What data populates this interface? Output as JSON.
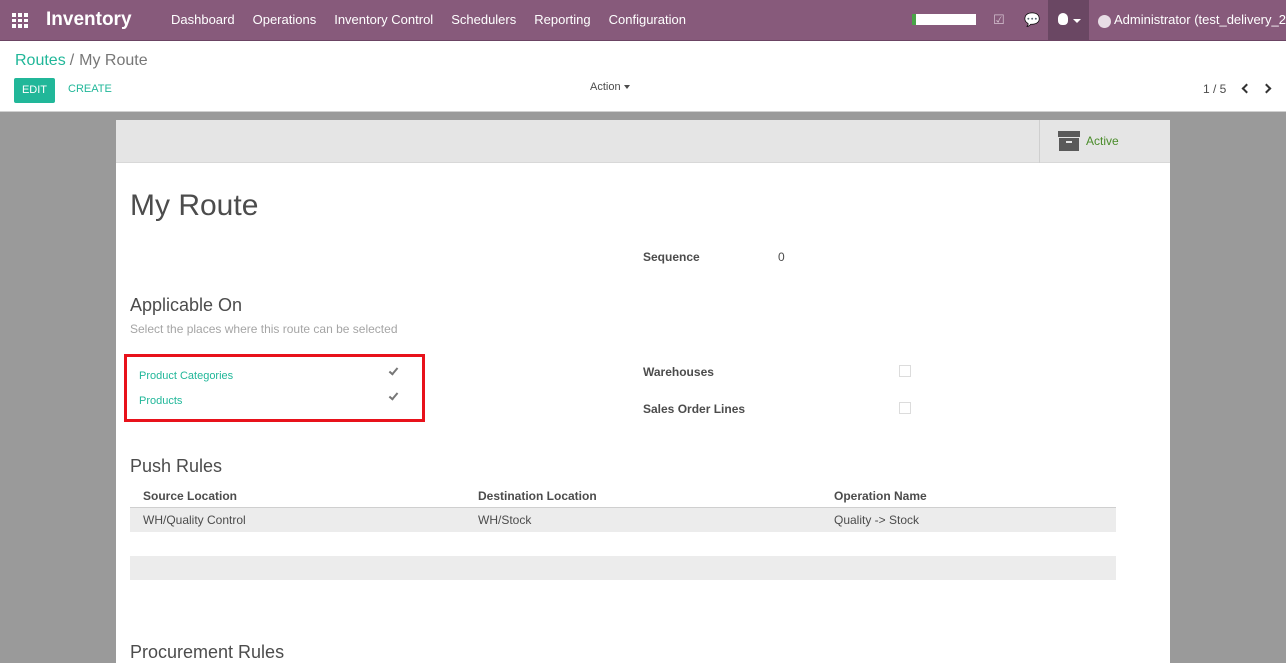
{
  "app": {
    "title": "Inventory"
  },
  "nav": {
    "menu": [
      "Dashboard",
      "Operations",
      "Inventory Control",
      "Schedulers",
      "Reporting",
      "Configuration"
    ],
    "icons": [
      "apps-grid-icon",
      "activity-check-icon",
      "chat-icon",
      "bug-icon"
    ],
    "user": "Administrator (test_delivery_2)",
    "progress_fraction": 0.06,
    "accent_color": "#875a7b"
  },
  "breadcrumb": {
    "parent": "Routes",
    "separator": "/",
    "current": "My Route"
  },
  "toolbar": {
    "edit_label": "EDIT",
    "create_label": "CREATE",
    "action_label": "Action",
    "pager": "1 / 5"
  },
  "record": {
    "status_label": "Active",
    "name": "My Route",
    "sequence_label": "Sequence",
    "sequence_value": "0"
  },
  "applicable_on": {
    "heading": "Applicable On",
    "hint": "Select the places where this route can be selected",
    "product_categories": {
      "label": "Product Categories",
      "checked": true
    },
    "products": {
      "label": "Products",
      "checked": true
    },
    "warehouses": {
      "label": "Warehouses",
      "checked": false
    },
    "sales_order_lines": {
      "label": "Sales Order Lines",
      "checked": false
    }
  },
  "push_rules": {
    "heading": "Push Rules",
    "columns": [
      "Source Location",
      "Destination Location",
      "Operation Name"
    ],
    "rows": [
      [
        "WH/Quality Control",
        "WH/Stock",
        "Quality -> Stock"
      ]
    ]
  },
  "procurement_rules": {
    "heading": "Procurement Rules"
  },
  "colors": {
    "link": "#21b799",
    "highlight_border": "#e8121b",
    "status_text": "#4a8c2a"
  }
}
